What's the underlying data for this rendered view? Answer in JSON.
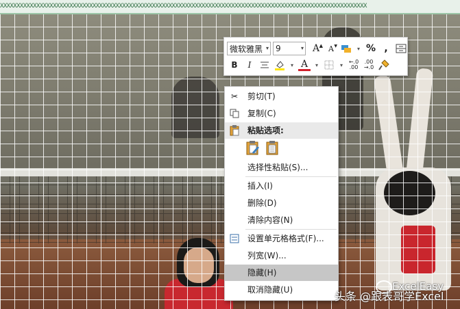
{
  "column_header_text": "XXXXXXXXXXXXXXXXXXXXXXXXXXXXXXXXXXXXXXXXXXXXXXXXXXXXXXXXXXXXXXXXXXXXXXXXXXXXXXXXXXXXXXXXXXXXXXXXXXXXXXXXXXXXXXX",
  "mini_toolbar": {
    "font_name": "微软雅黑",
    "font_size": "9",
    "grow_font_label": "A",
    "shrink_font_label": "A",
    "percent_label": "%",
    "comma_label": ",",
    "bold_label": "B",
    "italic_label": "I",
    "font_color_label": "A",
    "increase_decimal_label": "←.0\n.00",
    "decrease_decimal_label": ".00\n→.0",
    "icons": [
      "font-grow-icon",
      "font-shrink-icon",
      "accounting-format-icon",
      "percent-style-icon",
      "comma-style-icon",
      "merge-center-icon",
      "align-center-icon",
      "fill-color-icon",
      "font-color-icon",
      "borders-icon",
      "increase-decimal-icon",
      "decrease-decimal-icon",
      "format-painter-icon"
    ],
    "highlight_color": "#ffe600",
    "font_color": "#d1202a"
  },
  "context_menu": {
    "items": [
      {
        "label": "剪切(T)",
        "icon": "scissors-icon"
      },
      {
        "label": "复制(C)",
        "icon": "copy-icon"
      },
      {
        "label": "粘贴选项:",
        "icon": "paste-icon"
      },
      {
        "label": "选择性粘贴(S)...",
        "icon": ""
      },
      {
        "label": "插入(I)",
        "icon": ""
      },
      {
        "label": "删除(D)",
        "icon": ""
      },
      {
        "label": "清除内容(N)",
        "icon": ""
      },
      {
        "label": "设置单元格格式(F)...",
        "icon": "format-cells-icon"
      },
      {
        "label": "列宽(W)...",
        "icon": ""
      },
      {
        "label": "隐藏(H)",
        "icon": ""
      },
      {
        "label": "取消隐藏(U)",
        "icon": ""
      }
    ],
    "highlighted": "隐藏(H)"
  },
  "watermark": {
    "top_text": "ExcelEasy",
    "bottom_text": "头条 @跟表哥学Excel"
  }
}
